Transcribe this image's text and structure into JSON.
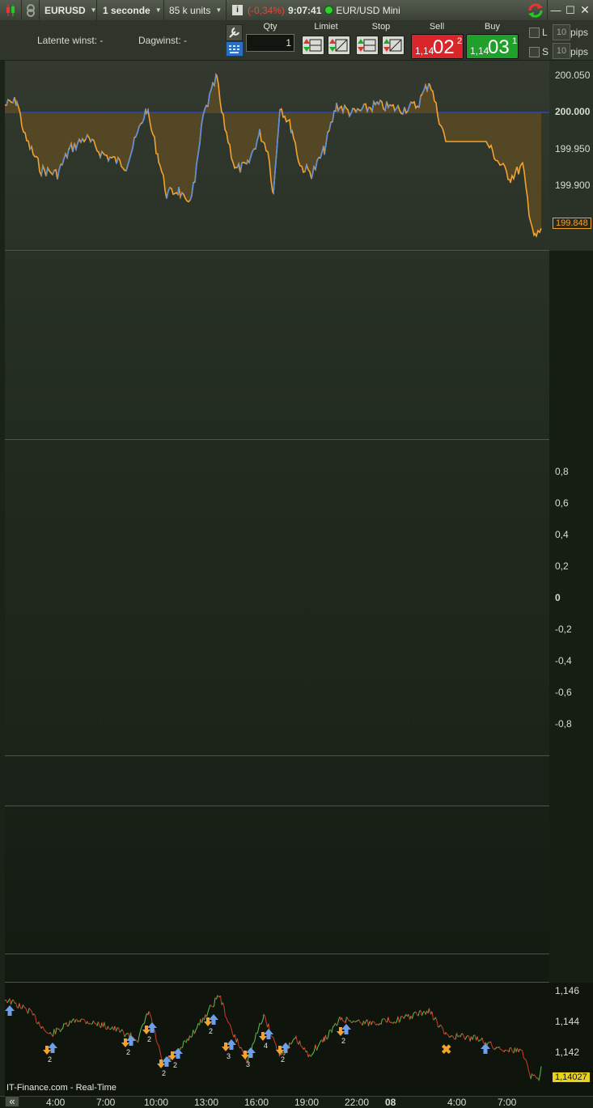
{
  "toolbar": {
    "symbol": "EURUSD",
    "timeframe": "1 seconde",
    "units": "85 k units",
    "change": "(-0,34%)",
    "time": "9:07:41",
    "instrument": "EUR/USD Mini",
    "colors": {
      "change": "#e04a3a",
      "status_dot": "#2fd02f"
    }
  },
  "order_panel": {
    "latent_label": "Latente winst:",
    "latent_value": "-",
    "day_label": "Dagwinst:",
    "day_value": "-",
    "qty_label": "Qty",
    "qty_value": "1",
    "limit_label": "Limiet",
    "stop_label": "Stop",
    "sell": {
      "label": "Sell",
      "small": "1,14",
      "big": "02",
      "sup": "2",
      "color": "#d8262b"
    },
    "buy": {
      "label": "Buy",
      "small": "1,14",
      "big": "03",
      "sup": "1",
      "color": "#1fa02a"
    },
    "long_label": "L",
    "short_label": "S",
    "pips_value": "10",
    "pips_label": "pips",
    "icons": [
      "candlestick-icon",
      "link-icon",
      "wrench-icon",
      "keypad-icon",
      "limit-order-icon",
      "stop-order-icon",
      "refresh-icon",
      "maximize-icon",
      "restore-icon",
      "close-icon",
      "info-icon"
    ]
  },
  "pane1": {
    "yticks": [
      "200.050",
      "200.000",
      "199.950",
      "199.900"
    ],
    "last_value": "199.848",
    "colors": {
      "line_up": "#5b8fe0",
      "line_down": "#f3a230",
      "fill": "#5a4a25",
      "ref_line": "#3248c8"
    }
  },
  "pane3": {
    "yticks": [
      "0,8",
      "0,6",
      "0,4",
      "0,2",
      "0",
      "-0,2",
      "-0,4",
      "-0,6",
      "-0,8"
    ]
  },
  "pane_price": {
    "yticks": [
      "1,146",
      "1,144",
      "1,142"
    ],
    "last_value": "1,14027",
    "signal_counts": [
      "2",
      "2",
      "2",
      "2",
      "2",
      "2",
      "3",
      "3",
      "4",
      "2",
      "2"
    ],
    "footer": "IT-Finance.com - Real-Time"
  },
  "xaxis": {
    "ticks": [
      "4:00",
      "7:00",
      "10:00",
      "13:00",
      "16:00",
      "19:00",
      "22:00",
      "08",
      "4:00",
      "7:00"
    ],
    "scroll_label": "«"
  }
}
